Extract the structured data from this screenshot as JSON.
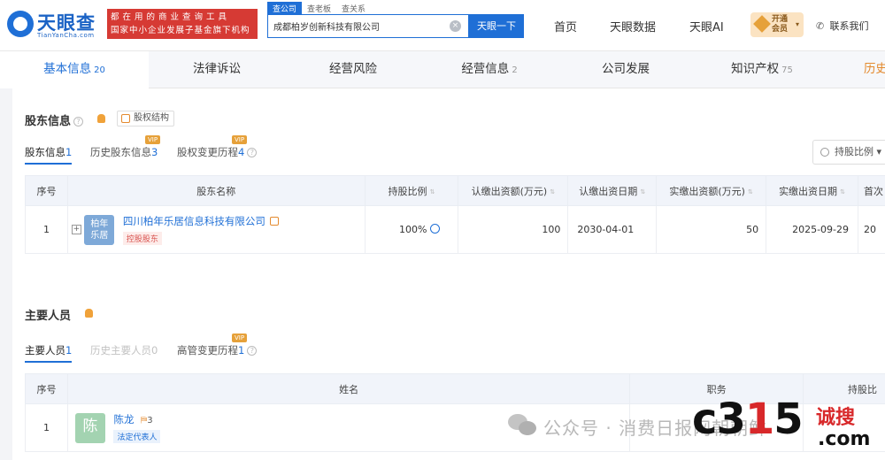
{
  "header": {
    "logo_text": "天眼查",
    "logo_sub": "TianYanCha.com",
    "slogan_line1": "都在用的商业查询工具",
    "slogan_line2": "国家中小企业发展子基金旗下机构",
    "search_tabs": [
      "查公司",
      "查老板",
      "查关系"
    ],
    "search_value": "成都柏岁创新科技有限公司",
    "search_button": "天眼一下",
    "nav": [
      "首页",
      "天眼数据",
      "天眼AI"
    ],
    "vip_line1": "开通",
    "vip_line2": "会员",
    "contact": "联系我们"
  },
  "tabs": [
    {
      "label": "基本信息",
      "count": "20"
    },
    {
      "label": "法律诉讼",
      "count": ""
    },
    {
      "label": "经营风险",
      "count": ""
    },
    {
      "label": "经营信息",
      "count": "2"
    },
    {
      "label": "公司发展",
      "count": ""
    },
    {
      "label": "知识产权",
      "count": "75"
    },
    {
      "label": "历史",
      "count": ""
    }
  ],
  "shareholders": {
    "title": "股东信息",
    "equity_button": "股权结构",
    "subtabs": [
      {
        "label": "股东信息",
        "num": "1",
        "vip": ""
      },
      {
        "label": "历史股东信息",
        "num": "3",
        "vip": "VIP"
      },
      {
        "label": "股权变更历程",
        "num": "4",
        "vip": "VIP"
      }
    ],
    "ratio_select": "持股比例",
    "columns": [
      "序号",
      "股东名称",
      "持股比例",
      "认缴出资额(万元)",
      "认缴出资日期",
      "实缴出资额(万元)",
      "实缴出资日期",
      "首次"
    ],
    "rows": [
      {
        "index": "1",
        "avatar_line1": "柏年",
        "avatar_line2": "乐居",
        "name": "四川柏年乐居信息科技有限公司",
        "tag": "控股股东",
        "ratio": "100%",
        "subscribed_amount": "100",
        "subscribed_date": "2030-04-01",
        "paid_amount": "50",
        "paid_date": "2025-09-29",
        "first": "20"
      }
    ]
  },
  "personnel": {
    "title": "主要人员",
    "subtabs": [
      {
        "label": "主要人员",
        "num": "1",
        "vip": ""
      },
      {
        "label": "历史主要人员",
        "num": "0",
        "vip": ""
      },
      {
        "label": "高管变更历程",
        "num": "1",
        "vip": "VIP"
      }
    ],
    "columns": [
      "序号",
      "姓名",
      "职务",
      "持股比"
    ],
    "rows": [
      {
        "index": "1",
        "avatar": "陈",
        "name": "陈龙",
        "count": "3",
        "tag": "法定代表人"
      }
    ]
  },
  "watermark": {
    "account": "公众号 · 消费日报网朝朝鲜",
    "brand_c": "c",
    "brand_3": "3",
    "brand_1": "1",
    "brand_5": "5",
    "brand_cn": "诚搜",
    "brand_com": ".com"
  }
}
